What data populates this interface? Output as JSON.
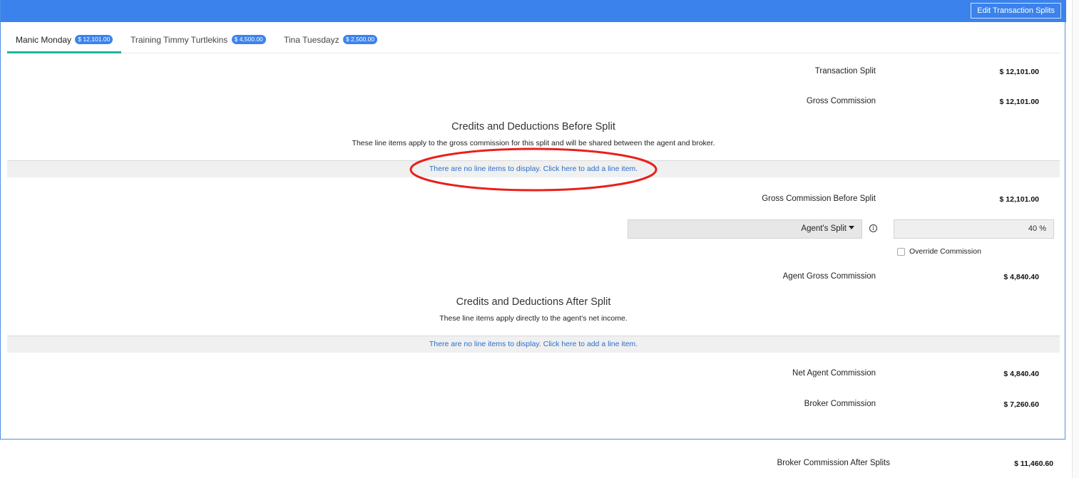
{
  "header": {
    "edit_button_label": "Edit Transaction Splits"
  },
  "tabs": [
    {
      "label": "Manic Monday",
      "badge": "$ 12,101.00",
      "active": true
    },
    {
      "label": "Training Timmy Turtlekins",
      "badge": "$ 4,500.00",
      "active": false
    },
    {
      "label": "Tina Tuesdayz",
      "badge": "$ 2,500.00",
      "active": false
    }
  ],
  "summary": {
    "transaction_split": {
      "label": "Transaction Split",
      "value": "$ 12,101.00"
    },
    "gross_commission": {
      "label": "Gross Commission",
      "value": "$ 12,101.00"
    },
    "gross_before_split": {
      "label": "Gross Commission Before Split",
      "value": "$ 12,101.00"
    },
    "agent_gross": {
      "label": "Agent Gross Commission",
      "value": "$ 4,840.40"
    },
    "net_agent": {
      "label": "Net Agent Commission",
      "value": "$ 4,840.40"
    },
    "broker": {
      "label": "Broker Commission",
      "value": "$ 7,260.60"
    },
    "broker_after_splits": {
      "label": "Broker Commission After Splits",
      "value": "$ 11,460.60"
    }
  },
  "before_split": {
    "title": "Credits and Deductions Before Split",
    "subtitle": "These line items apply to the gross commission for this split and will be shared between the agent and broker.",
    "empty_text": "There are no line items to display. Click here to add a line item."
  },
  "after_split": {
    "title": "Credits and Deductions After Split",
    "subtitle": "These line items apply directly to the agent's net income.",
    "empty_text": "There are no line items to display. Click here to add a line item."
  },
  "split_control": {
    "select_value": "Agent's Split",
    "percent_value": "40 %",
    "info_glyph": "i",
    "override_label": "Override Commission",
    "override_checked": false
  },
  "annotation": {
    "shape": "ellipse",
    "color": "#e8201b"
  }
}
